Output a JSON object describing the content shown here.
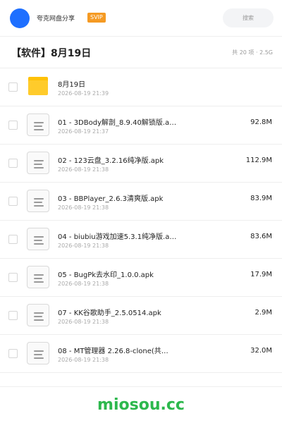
{
  "header": {
    "avatar_icon": "user-avatar",
    "app_name": "夸克网盘分享",
    "badge": "SVIP",
    "search_label": "搜索"
  },
  "folder": {
    "title": "【软件】8月19日",
    "meta": "共 20 项 · 2.5G"
  },
  "files": [
    {
      "name": "8月19日",
      "date": "2026-08-19 21:39",
      "size": "",
      "type": "folder"
    },
    {
      "name": "01 - 3DBody解剖_8.9.40解锁版.a…",
      "date": "2026-08-19 21:37",
      "size": "92.8M",
      "type": "file"
    },
    {
      "name": "02 - 123云盘_3.2.16纯净版.apk",
      "date": "2026-08-19 21:38",
      "size": "112.9M",
      "type": "file"
    },
    {
      "name": "03 - BBPlayer_2.6.3清爽版.apk",
      "date": "2026-08-19 21:38",
      "size": "83.9M",
      "type": "file"
    },
    {
      "name": "04 - biubiu游戏加速5.3.1纯净版.a…",
      "date": "2026-08-19 21:38",
      "size": "83.6M",
      "type": "file"
    },
    {
      "name": "05 - BugPk去水印_1.0.0.apk",
      "date": "2026-08-19 21:38",
      "size": "17.9M",
      "type": "file"
    },
    {
      "name": "07 - KK谷歌助手_2.5.0514.apk",
      "date": "2026-08-19 21:38",
      "size": "2.9M",
      "type": "file"
    },
    {
      "name": "08 - MT管理器 2.26.8-clone(共…",
      "date": "2026-08-19 21:38",
      "size": "32.0M",
      "type": "file"
    }
  ],
  "watermark": "miosou.cc",
  "colors": {
    "accent": "#1e6fff",
    "badge": "#f59a23",
    "folder": "#ffcb2b",
    "watermark": "#2db84d"
  }
}
